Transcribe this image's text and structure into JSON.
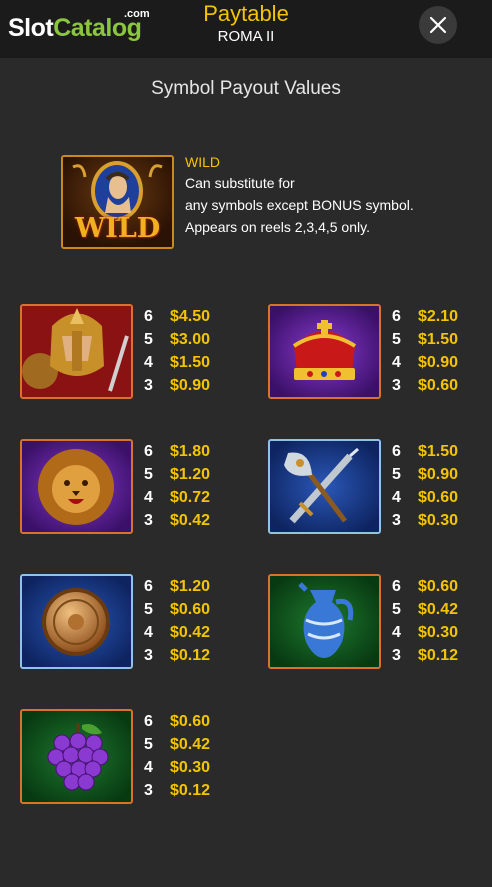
{
  "header": {
    "logo_text_slot": "Slot",
    "logo_text_catalog": "Catalog",
    "logo_text_com": ".com",
    "title": "Paytable",
    "subtitle": "ROMA II"
  },
  "section_title": "Symbol Payout Values",
  "wild": {
    "name": "WILD",
    "tile_label": "WILD",
    "line1": "Can substitute for",
    "line2": "any symbols except BONUS symbol.",
    "line3": "Appears on reels 2,3,4,5 only."
  },
  "symbols": [
    {
      "icon": "gladiator-icon",
      "frame": "red",
      "payouts": [
        {
          "count": "6",
          "value": "$4.50"
        },
        {
          "count": "5",
          "value": "$3.00"
        },
        {
          "count": "4",
          "value": "$1.50"
        },
        {
          "count": "3",
          "value": "$0.90"
        }
      ]
    },
    {
      "icon": "crown-icon",
      "frame": "purple",
      "payouts": [
        {
          "count": "6",
          "value": "$2.10"
        },
        {
          "count": "5",
          "value": "$1.50"
        },
        {
          "count": "4",
          "value": "$0.90"
        },
        {
          "count": "3",
          "value": "$0.60"
        }
      ]
    },
    {
      "icon": "lion-icon",
      "frame": "purple",
      "payouts": [
        {
          "count": "6",
          "value": "$1.80"
        },
        {
          "count": "5",
          "value": "$1.20"
        },
        {
          "count": "4",
          "value": "$0.72"
        },
        {
          "count": "3",
          "value": "$0.42"
        }
      ]
    },
    {
      "icon": "axe-sword-icon",
      "frame": "blue",
      "payouts": [
        {
          "count": "6",
          "value": "$1.50"
        },
        {
          "count": "5",
          "value": "$0.90"
        },
        {
          "count": "4",
          "value": "$0.60"
        },
        {
          "count": "3",
          "value": "$0.30"
        }
      ]
    },
    {
      "icon": "shield-icon",
      "frame": "blue",
      "payouts": [
        {
          "count": "6",
          "value": "$1.20"
        },
        {
          "count": "5",
          "value": "$0.60"
        },
        {
          "count": "4",
          "value": "$0.42"
        },
        {
          "count": "3",
          "value": "$0.12"
        }
      ]
    },
    {
      "icon": "vase-icon",
      "frame": "green",
      "payouts": [
        {
          "count": "6",
          "value": "$0.60"
        },
        {
          "count": "5",
          "value": "$0.42"
        },
        {
          "count": "4",
          "value": "$0.30"
        },
        {
          "count": "3",
          "value": "$0.12"
        }
      ]
    },
    {
      "icon": "grapes-icon",
      "frame": "green",
      "payouts": [
        {
          "count": "6",
          "value": "$0.60"
        },
        {
          "count": "5",
          "value": "$0.42"
        },
        {
          "count": "4",
          "value": "$0.30"
        },
        {
          "count": "3",
          "value": "$0.12"
        }
      ]
    }
  ],
  "colors": {
    "accent_gold": "#f5c400",
    "brand_green": "#8cc63f",
    "background": "#2a2a2a",
    "header_bg": "#1b1b1b"
  }
}
